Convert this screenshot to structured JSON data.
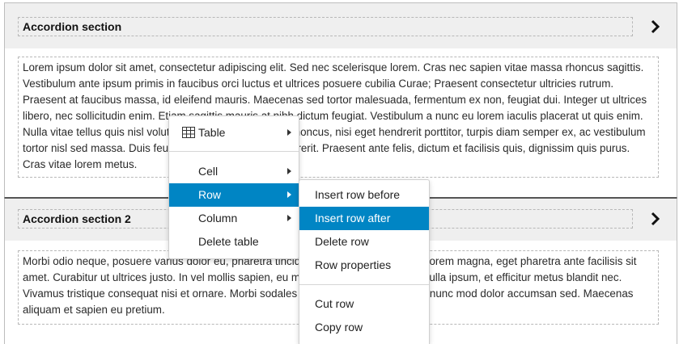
{
  "accordions": [
    {
      "title": "Accordion section",
      "body": "Lorem ipsum dolor sit amet, consectetur adipiscing elit. Sed nec scelerisque lorem. Cras nec sapien vitae massa rhoncus sagittis. Vestibulum ante ipsum primis in faucibus orci luctus et ultrices posuere cubilia Curae; Praesent consectetur ultricies rutrum. Praesent at faucibus massa, id eleifend mauris. Maecenas sed tortor malesuada, fermentum ex non, feugiat dui. Integer ut ultrices libero, nec sollicitudin enim. Etiam sagittis mauris at nibh dictum feugiat. Vestibulum a nunc eu lorem iaculis placerat ut quis enim. Nulla vitae tellus quis nisl volutpat viverra semper. Nam rhoncus, nisi eget hendrerit porttitor, turpis diam semper ex, ac vestibulum tortor nisl sed massa. Duis feugiat feugiat risus quis hendrerit. Praesent ante felis, dictum et facilisis quis, dignissim quis purus. Cras vitae lorem metus."
    },
    {
      "title": "Accordion section 2",
      "body": "Morbi odio neque, posuere varius dolor eu, pharetra tincidunt lorem. Aenean feugiat lorem magna, eget pharetra ante facilisis sit amet. Curabitur ut ultrices justo. In vel mollis sapien, eu mollis urna. Aliquam mattis nulla ipsum, et efficitur metus blandit nec. Vivamus tristique consequat nisi et ornare. Morbi sodales lectus ex, vitae fermentum nunc mod dolor accumsan sed. Maecenas aliquam et sapien eu pretium."
    }
  ],
  "context_menu": {
    "items": [
      {
        "label": "Table",
        "icon": "table-icon",
        "has_submenu": true
      },
      {
        "label": "Cell",
        "has_submenu": true
      },
      {
        "label": "Row",
        "has_submenu": true,
        "active": true
      },
      {
        "label": "Column",
        "has_submenu": true
      },
      {
        "label": "Delete table",
        "has_submenu": false
      }
    ]
  },
  "row_submenu": {
    "items": [
      {
        "label": "Insert row before"
      },
      {
        "label": "Insert row after",
        "active": true
      },
      {
        "label": "Delete row"
      },
      {
        "label": "Row properties"
      },
      {
        "label": "Cut row"
      },
      {
        "label": "Copy row"
      }
    ]
  },
  "colors": {
    "menu_active": "#0085c4",
    "header_bg": "#efefef",
    "spellcheck": "#dd3333"
  }
}
